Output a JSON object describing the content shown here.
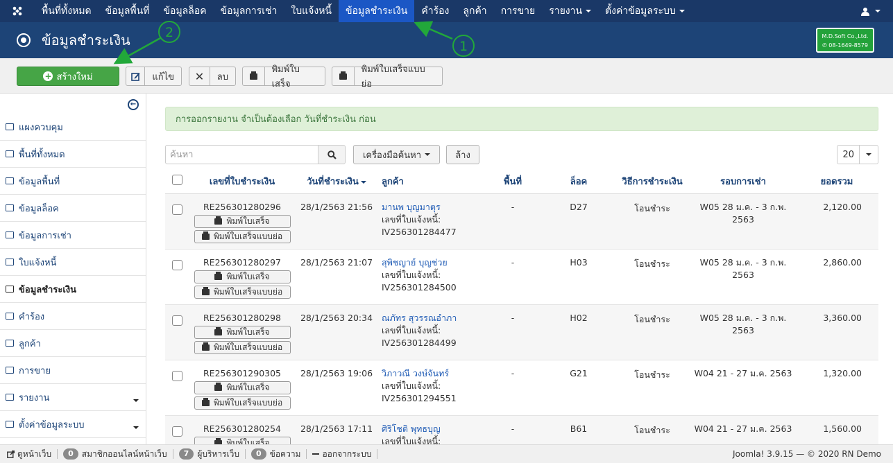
{
  "topnav": {
    "items": [
      {
        "label": "พื้นที่ทั้งหมด",
        "caret": false,
        "active": false
      },
      {
        "label": "ข้อมูลพื้นที่",
        "caret": false,
        "active": false
      },
      {
        "label": "ข้อมูลล็อค",
        "caret": false,
        "active": false
      },
      {
        "label": "ข้อมูลการเช่า",
        "caret": false,
        "active": false
      },
      {
        "label": "ใบแจ้งหนี้",
        "caret": false,
        "active": false
      },
      {
        "label": "ข้อมูลชำระเงิน",
        "caret": false,
        "active": true
      },
      {
        "label": "คำร้อง",
        "caret": false,
        "active": false
      },
      {
        "label": "ลูกค้า",
        "caret": false,
        "active": false
      },
      {
        "label": "การขาย",
        "caret": false,
        "active": false
      },
      {
        "label": "รายงาน",
        "caret": true,
        "active": false
      },
      {
        "label": "ตั้งค่าข้อมูลระบบ",
        "caret": true,
        "active": false
      }
    ]
  },
  "header": {
    "title": "ข้อมูลชำระเงิน",
    "brand_line1": "M.D.Soft Co.,Ltd.",
    "brand_line2": "08-1649-8579"
  },
  "toolbar": {
    "new_label": "สร้างใหม่",
    "edit_label": "แก้ไข",
    "delete_label": "ลบ",
    "print_label": "พิมพ์ใบเสร็จ",
    "print_short_label": "พิมพ์ใบเสร็จแบบย่อ"
  },
  "sidebar": {
    "items": [
      {
        "label": "แผงควบคุม",
        "active": false,
        "caret": false
      },
      {
        "label": "พื้นที่ทั้งหมด",
        "active": false,
        "caret": false
      },
      {
        "label": "ข้อมูลพื้นที่",
        "active": false,
        "caret": false
      },
      {
        "label": "ข้อมูลล็อค",
        "active": false,
        "caret": false
      },
      {
        "label": "ข้อมูลการเช่า",
        "active": false,
        "caret": false
      },
      {
        "label": "ใบแจ้งหนี้",
        "active": false,
        "caret": false
      },
      {
        "label": "ข้อมูลชำระเงิน",
        "active": true,
        "caret": false
      },
      {
        "label": "คำร้อง",
        "active": false,
        "caret": false
      },
      {
        "label": "ลูกค้า",
        "active": false,
        "caret": false
      },
      {
        "label": "การขาย",
        "active": false,
        "caret": false
      },
      {
        "label": "รายงาน",
        "active": false,
        "caret": true
      },
      {
        "label": "ตั้งค่าข้อมูลระบบ",
        "active": false,
        "caret": true
      }
    ]
  },
  "alert": {
    "text": "การออกรายงาน จำเป็นต้องเลือก วันที่ชำระเงิน ก่อน"
  },
  "search": {
    "placeholder": "ค้นหา",
    "tools_label": "เครื่องมือค้นหา",
    "clear_label": "ล้าง",
    "limit": "20"
  },
  "table": {
    "columns": {
      "receipt": "เลขที่ใบชำระเงิน",
      "date": "วันที่ชำระเงิน",
      "customer": "ลูกค้า",
      "area": "พื้นที่",
      "lock": "ล็อค",
      "method": "วิธีการชำระเงิน",
      "round": "รอบการเช่า",
      "total": "ยอดรวม"
    },
    "print_label": "พิมพ์ใบเสร็จ",
    "print_short_label": "พิมพ์ใบเสร็จแบบย่อ",
    "invoice_prefix": "เลขที่ใบแจ้งหนี้:",
    "rows": [
      {
        "receipt": "RE256301280296",
        "date": "28/1/2563 21:56",
        "customer": "มานพ บุญมาตุร",
        "invoice": "IV256301284477",
        "area": "-",
        "lock": "D27",
        "method": "โอนชำระ",
        "round": "W05 28 ม.ค. - 3 ก.พ. 2563",
        "total": "2,120.00"
      },
      {
        "receipt": "RE256301280297",
        "date": "28/1/2563 21:07",
        "customer": "สุพิชญาย์ บุญช่วย",
        "invoice": "IV256301284500",
        "area": "-",
        "lock": "H03",
        "method": "โอนชำระ",
        "round": "W05 28 ม.ค. - 3 ก.พ. 2563",
        "total": "2,860.00"
      },
      {
        "receipt": "RE256301280298",
        "date": "28/1/2563 20:34",
        "customer": "ณภัทร สุวรรณอำภา",
        "invoice": "IV256301284499",
        "area": "-",
        "lock": "H02",
        "method": "โอนชำระ",
        "round": "W05 28 ม.ค. - 3 ก.พ. 2563",
        "total": "3,360.00"
      },
      {
        "receipt": "RE256301290305",
        "date": "28/1/2563 19:06",
        "customer": "วิภาวณี วงษ์จันทร์",
        "invoice": "IV256301294551",
        "area": "-",
        "lock": "G21",
        "method": "โอนชำระ",
        "round": "W04 21 - 27 ม.ค. 2563",
        "total": "1,320.00"
      },
      {
        "receipt": "RE256301280254",
        "date": "28/1/2563 17:11",
        "customer": "ศิริโชติ พุทธบุญ",
        "invoice": "",
        "area": "-",
        "lock": "B61",
        "method": "โอนชำระ",
        "round": "W04 21 - 27 ม.ค. 2563",
        "total": "1,560.00"
      }
    ]
  },
  "footer": {
    "view_site": "ดูหน้าเว็บ",
    "visitors_count": "0",
    "visitors_label": "สมาชิกออนไลน์หน้าเว็บ",
    "admins_count": "7",
    "admins_label": "ผู้บริหารเว็บ",
    "messages_count": "0",
    "messages_label": "ข้อความ",
    "logout": "ออกจากระบบ",
    "version": "Joomla! 3.9.15",
    "copyright": "© 2020 RN Demo"
  },
  "annotations": [
    {
      "label": "1"
    },
    {
      "label": "2"
    }
  ],
  "colors": {
    "nav": "#1a3867",
    "header": "#1d4477",
    "active": "#1b57c5",
    "new_button": "#46a546",
    "annotation": "#22a83a"
  }
}
